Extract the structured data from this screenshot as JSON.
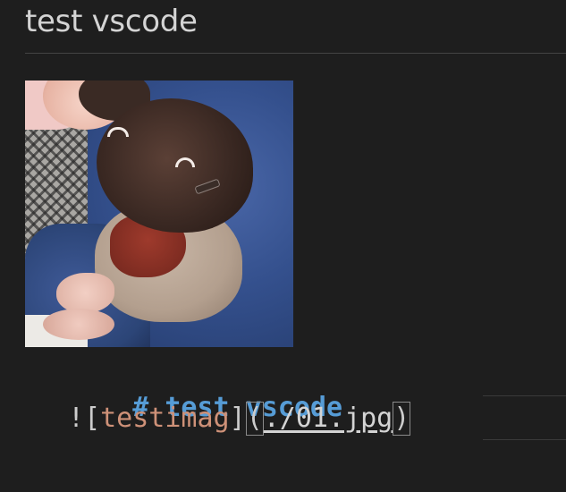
{
  "preview": {
    "heading": "test vscode",
    "image_alt": "testimag"
  },
  "source": {
    "heading_line": "# test vscode",
    "image_line": {
      "bang": "!",
      "open_bracket": "[",
      "alt_text": "testimag",
      "close_bracket": "]",
      "open_paren": "(",
      "url": "./01.jpg",
      "close_paren": ")"
    }
  },
  "colors": {
    "background": "#1e1e1e",
    "heading_keyword": "#569cd6",
    "alt_text": "#ce9178",
    "preview_text": "#d4d4d4"
  }
}
